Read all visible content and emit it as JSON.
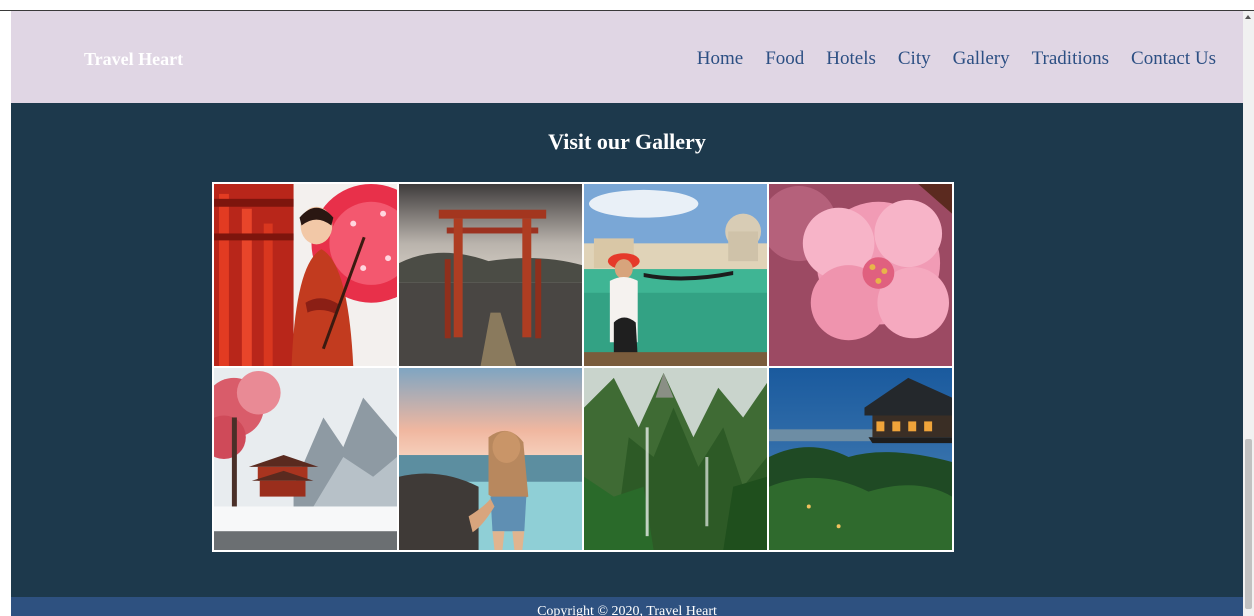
{
  "header": {
    "brand": "Travel Heart",
    "nav": [
      {
        "label": "Home"
      },
      {
        "label": "Food"
      },
      {
        "label": "Hotels"
      },
      {
        "label": "City"
      },
      {
        "label": "Gallery"
      },
      {
        "label": "Traditions"
      },
      {
        "label": "Contact Us"
      }
    ]
  },
  "gallery": {
    "title": "Visit our Gallery",
    "photos": [
      {
        "subject": "woman-with-red-parasol"
      },
      {
        "subject": "torii-gate-in-water"
      },
      {
        "subject": "venice-gondola"
      },
      {
        "subject": "pink-blossom"
      },
      {
        "subject": "winter-pagoda"
      },
      {
        "subject": "beach-girl"
      },
      {
        "subject": "green-mountains"
      },
      {
        "subject": "temple-at-night"
      }
    ]
  },
  "footer": {
    "copyright": "Copyright © 2020, Travel Heart"
  },
  "colors": {
    "header_bg": "#e0d6e4",
    "nav_link": "#2c4f83",
    "main_bg": "#1d394c",
    "footer_bg": "#2e5180"
  }
}
